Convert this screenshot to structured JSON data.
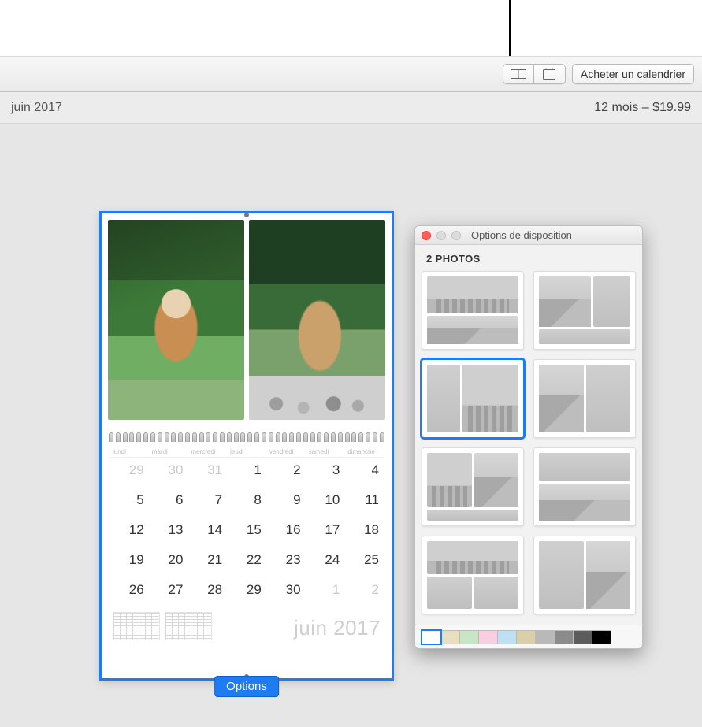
{
  "toolbar": {
    "buy_label": "Acheter un calendrier"
  },
  "subheader": {
    "month": "juin 2017",
    "price": "12 mois – $19.99"
  },
  "calendar": {
    "month_label": "juin 2017",
    "dow": [
      "lundi",
      "mardi",
      "mercredi",
      "jeudi",
      "vendredi",
      "samedi",
      "dimanche"
    ],
    "grid": [
      [
        {
          "n": "29",
          "dim": true
        },
        {
          "n": "30",
          "dim": true
        },
        {
          "n": "31",
          "dim": true
        },
        {
          "n": "1"
        },
        {
          "n": "2"
        },
        {
          "n": "3"
        },
        {
          "n": "4"
        }
      ],
      [
        {
          "n": "5"
        },
        {
          "n": "6"
        },
        {
          "n": "7"
        },
        {
          "n": "8"
        },
        {
          "n": "9"
        },
        {
          "n": "10"
        },
        {
          "n": "11"
        }
      ],
      [
        {
          "n": "12"
        },
        {
          "n": "13"
        },
        {
          "n": "14"
        },
        {
          "n": "15"
        },
        {
          "n": "16"
        },
        {
          "n": "17"
        },
        {
          "n": "18"
        }
      ],
      [
        {
          "n": "19"
        },
        {
          "n": "20"
        },
        {
          "n": "21"
        },
        {
          "n": "22"
        },
        {
          "n": "23"
        },
        {
          "n": "24"
        },
        {
          "n": "25"
        }
      ],
      [
        {
          "n": "26"
        },
        {
          "n": "27"
        },
        {
          "n": "28"
        },
        {
          "n": "29"
        },
        {
          "n": "30"
        },
        {
          "n": "1",
          "dim": true
        },
        {
          "n": "2",
          "dim": true
        }
      ]
    ],
    "options_button": "Options"
  },
  "popover": {
    "title": "Options de disposition",
    "section_label": "2 PHOTOS",
    "layouts": [
      {
        "id": "layout-1",
        "selected": false
      },
      {
        "id": "layout-2",
        "selected": false
      },
      {
        "id": "layout-3",
        "selected": true
      },
      {
        "id": "layout-4",
        "selected": false
      },
      {
        "id": "layout-5",
        "selected": false
      },
      {
        "id": "layout-6",
        "selected": false
      },
      {
        "id": "layout-7",
        "selected": false
      },
      {
        "id": "layout-8",
        "selected": false
      }
    ],
    "colors": [
      {
        "hex": "#ffffff",
        "selected": true
      },
      {
        "hex": "#e7dfc0",
        "selected": false
      },
      {
        "hex": "#c7e6c6",
        "selected": false
      },
      {
        "hex": "#f7cfe0",
        "selected": false
      },
      {
        "hex": "#bfe0f2",
        "selected": false
      },
      {
        "hex": "#d9cfa8",
        "selected": false
      },
      {
        "hex": "#b9b9b9",
        "selected": false
      },
      {
        "hex": "#8b8b8b",
        "selected": false
      },
      {
        "hex": "#5c5c5c",
        "selected": false
      },
      {
        "hex": "#000000",
        "selected": false
      }
    ]
  }
}
